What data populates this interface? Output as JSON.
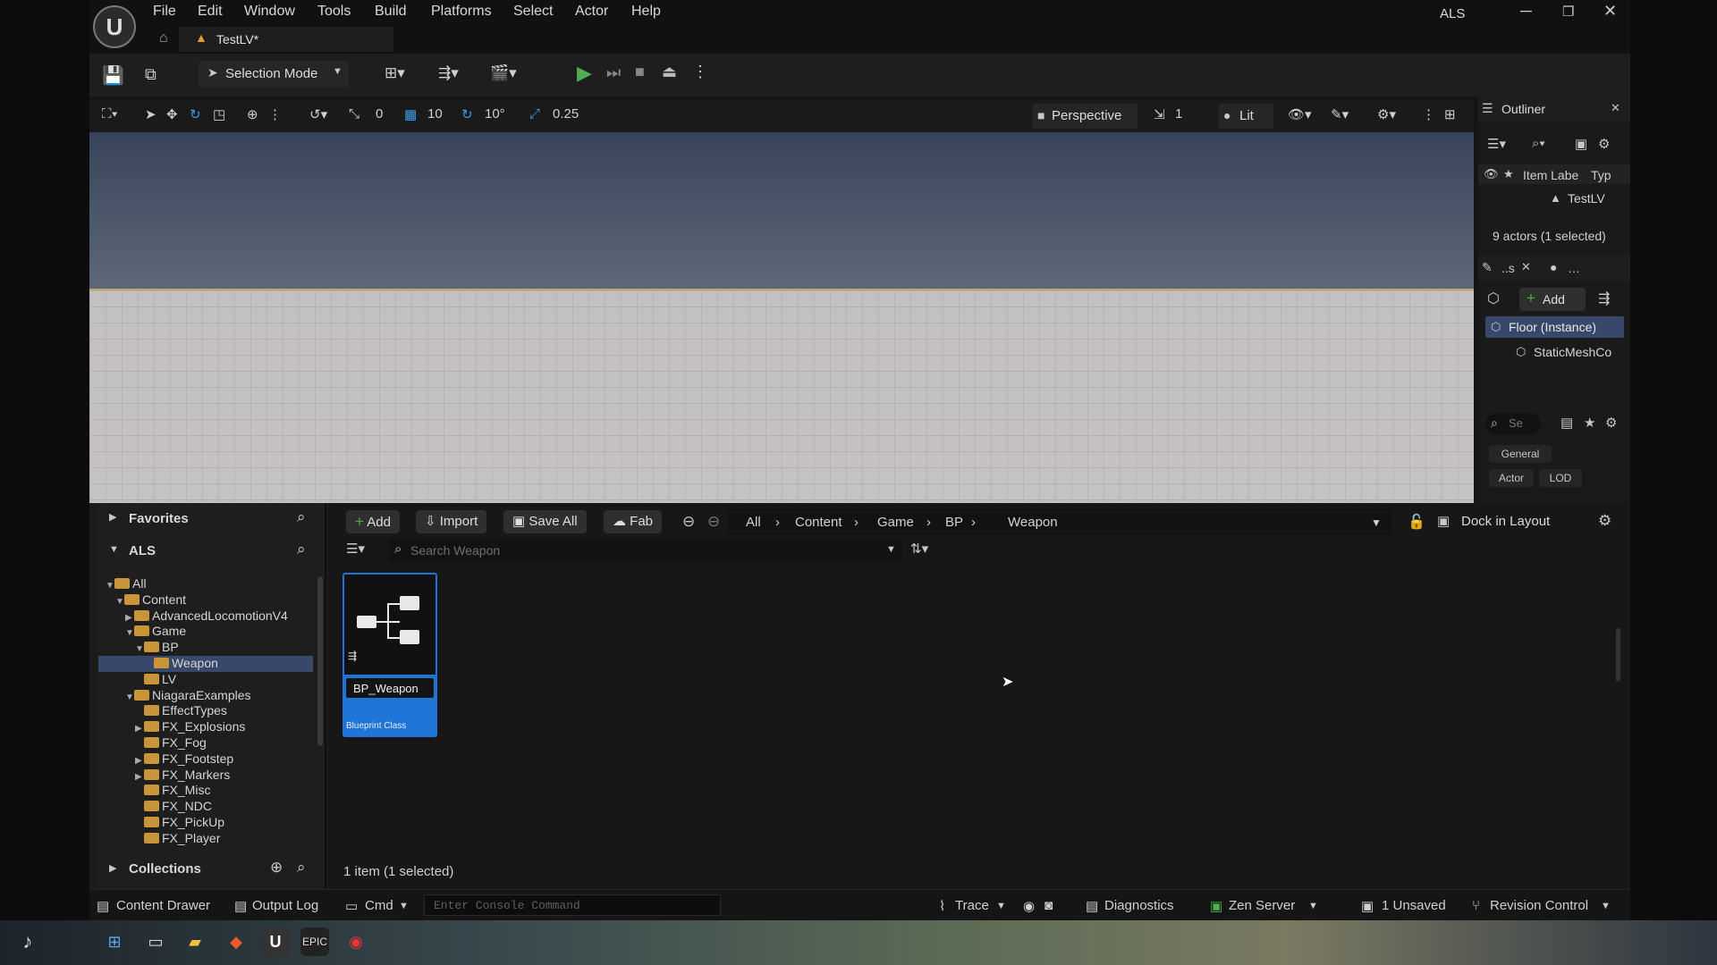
{
  "title_bar": {
    "menus": [
      "File",
      "Edit",
      "Window",
      "Tools",
      "Build",
      "Platforms",
      "Select",
      "Actor",
      "Help"
    ],
    "project": "ALS",
    "level_tab": "TestLV*"
  },
  "toolbar": {
    "mode": "Selection Mode"
  },
  "viewport_toolbar": {
    "rotate_snap": "0",
    "grid_snap": "10",
    "angle_snap": "10°",
    "scale_snap": "0.25",
    "perspective": "Perspective",
    "camera_speed": "1",
    "lit": "Lit"
  },
  "outliner": {
    "title": "Outliner",
    "col_label": "Item Labe",
    "col_type": "Typ",
    "row": "TestLV",
    "actors_count": "9 actors (1 selected)"
  },
  "details": {
    "tab_label": "..s",
    "add_label": "Add",
    "selected_component": "Floor (Instance)",
    "child_component": "StaticMeshCo",
    "search_placeholder": "Se",
    "categories": [
      "General",
      "Actor",
      "LOD"
    ]
  },
  "content_browser": {
    "favorites": "Favorites",
    "als": "ALS",
    "collections": "Collections",
    "add": "Add",
    "import": "Import",
    "save_all": "Save All",
    "fab": "Fab",
    "breadcrumbs": [
      "All",
      "Content",
      "Game",
      "BP",
      "Weapon"
    ],
    "dock_in_layout": "Dock in Layout",
    "search_placeholder": "Search Weapon",
    "tree": [
      {
        "label": "All",
        "indent": 0,
        "arrow": "▼"
      },
      {
        "label": "Content",
        "indent": 1,
        "arrow": "▼"
      },
      {
        "label": "AdvancedLocomotionV4",
        "indent": 2,
        "arrow": "▶"
      },
      {
        "label": "Game",
        "indent": 2,
        "arrow": "▼"
      },
      {
        "label": "BP",
        "indent": 3,
        "arrow": "▼"
      },
      {
        "label": "Weapon",
        "indent": 4,
        "arrow": ""
      },
      {
        "label": "LV",
        "indent": 3,
        "arrow": ""
      },
      {
        "label": "NiagaraExamples",
        "indent": 2,
        "arrow": "▼"
      },
      {
        "label": "EffectTypes",
        "indent": 3,
        "arrow": ""
      },
      {
        "label": "FX_Explosions",
        "indent": 3,
        "arrow": "▶"
      },
      {
        "label": "FX_Fog",
        "indent": 3,
        "arrow": ""
      },
      {
        "label": "FX_Footstep",
        "indent": 3,
        "arrow": "▶"
      },
      {
        "label": "FX_Markers",
        "indent": 3,
        "arrow": "▶"
      },
      {
        "label": "FX_Misc",
        "indent": 3,
        "arrow": ""
      },
      {
        "label": "FX_NDC",
        "indent": 3,
        "arrow": ""
      },
      {
        "label": "FX_PickUp",
        "indent": 3,
        "arrow": ""
      },
      {
        "label": "FX_Player",
        "indent": 3,
        "arrow": ""
      }
    ],
    "selected_folder": "Weapon",
    "asset": {
      "name": "BP_Weapon",
      "type": "Blueprint Class"
    },
    "item_count": "1 item (1 selected)"
  },
  "status_bar": {
    "content_drawer": "Content Drawer",
    "output_log": "Output Log",
    "cmd": "Cmd",
    "console_placeholder": "Enter Console Command",
    "trace": "Trace",
    "diagnostics": "Diagnostics",
    "zen_server": "Zen Server",
    "unsaved": "1 Unsaved",
    "revision_control": "Revision Control"
  },
  "colors": {
    "accent_blue": "#1f74d8",
    "selection": "#38486a",
    "play_green": "#4caf50",
    "folder": "#c8953b"
  }
}
